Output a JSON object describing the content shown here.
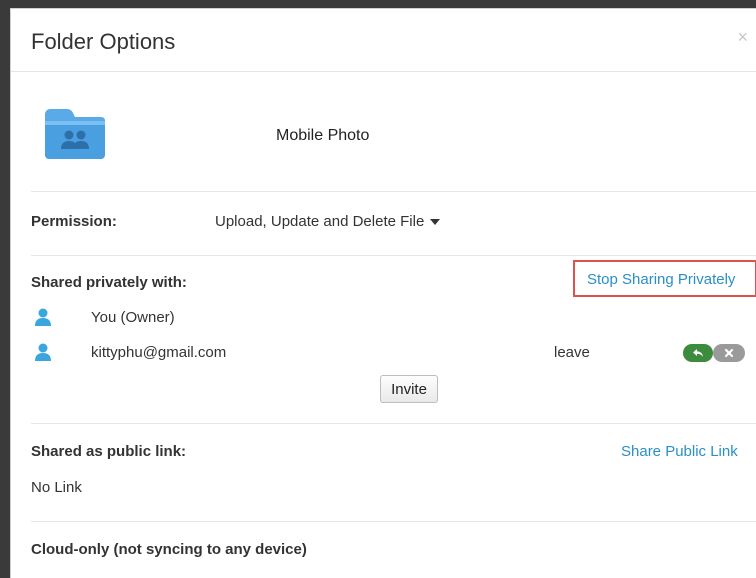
{
  "dialog": {
    "title": "Folder Options",
    "close_symbol": "×"
  },
  "folder": {
    "name": "Mobile Photo",
    "icon": "shared-folder-icon",
    "color": "#4a9fe0"
  },
  "permission": {
    "label": "Permission:",
    "value": "Upload, Update and Delete File"
  },
  "shared_private": {
    "label": "Shared privately with:",
    "stop_link": "Stop Sharing Privately",
    "users": [
      {
        "name": "You (Owner)",
        "icon": "user-icon"
      },
      {
        "name": "kittyphu@gmail.com",
        "status": "leave",
        "icon": "user-icon"
      }
    ],
    "invite_label": "Invite"
  },
  "public_link": {
    "label": "Shared as public link:",
    "share_link": "Share Public Link",
    "value": "No Link"
  },
  "cloud": {
    "label": "Cloud-only (not syncing to any device)"
  },
  "colors": {
    "link": "#2a8fc7",
    "highlight_border": "#d9534f",
    "accept_button": "#3d8b3d",
    "remove_button": "#9a9a9a"
  }
}
